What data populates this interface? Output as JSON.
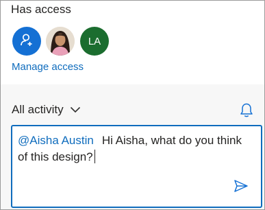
{
  "access": {
    "title": "Has access",
    "avatars": [
      {
        "kind": "add-people",
        "icon": "add-person-icon",
        "color": "#1470d4"
      },
      {
        "kind": "photo",
        "icon": "user-photo",
        "color": "#e9e1d6"
      },
      {
        "kind": "initials",
        "initials": "LA",
        "color": "#1b6d2f"
      }
    ],
    "manage_link": "Manage access"
  },
  "activity": {
    "filter_label": "All activity",
    "chevron_icon": "chevron-down-icon",
    "bell_icon": "bell-icon"
  },
  "comment": {
    "mention": "@Aisha Austin",
    "text": "Hi Aisha, what do you think of this design?",
    "send_icon": "send-icon",
    "accent": "#0f6cbd"
  }
}
